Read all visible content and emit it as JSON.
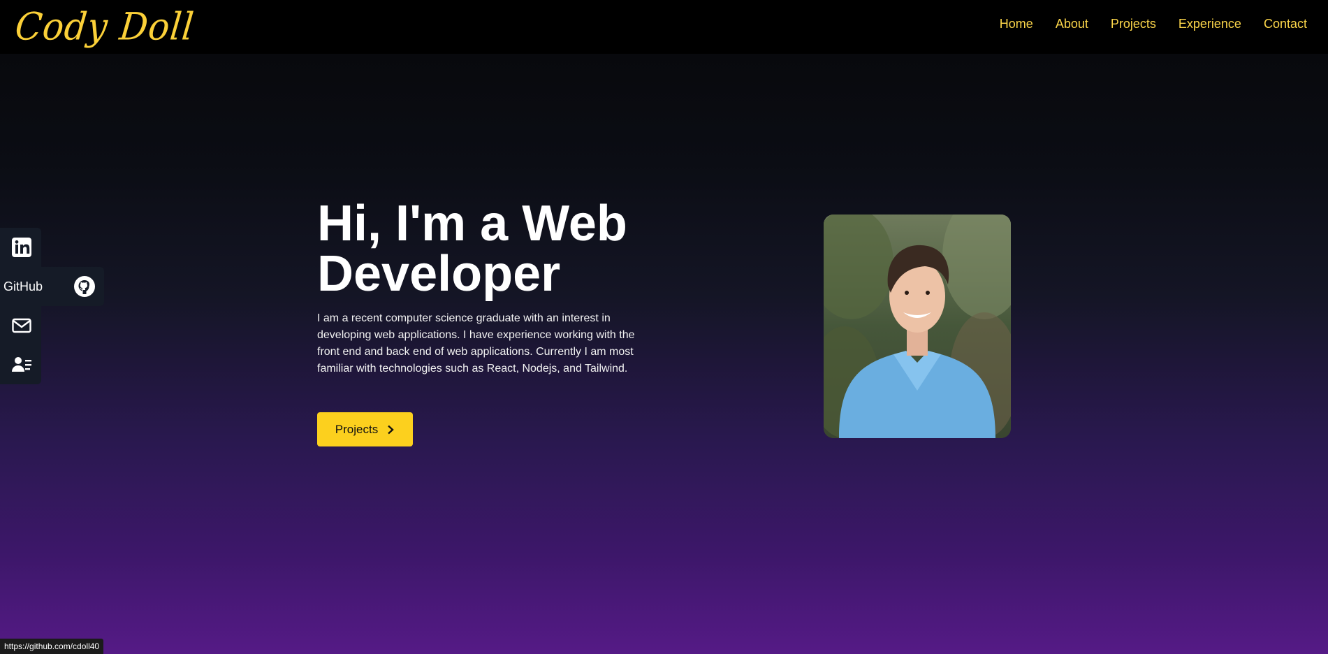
{
  "brand": {
    "logo_text": "Cody Doll",
    "accent": "#fcd01e"
  },
  "nav": {
    "items": [
      "Home",
      "About",
      "Projects",
      "Experience",
      "Contact"
    ]
  },
  "social": {
    "linkedin": {
      "icon": "linkedin-icon"
    },
    "github": {
      "label": "GitHub",
      "icon": "github-icon"
    },
    "email": {
      "icon": "mail-icon"
    },
    "resume": {
      "icon": "resume-icon"
    }
  },
  "hero": {
    "title_line1": "Hi, I'm a Web",
    "title_line2": "Developer",
    "description": "I am a recent computer science graduate with an interest in developing web applications. I have experience working with the front end and back end of web applications. Currently I am most familiar with technologies such as React, Nodejs, and Tailwind.",
    "cta_label": "Projects"
  },
  "status_bar": {
    "url": "https://github.com/cdoll40"
  }
}
